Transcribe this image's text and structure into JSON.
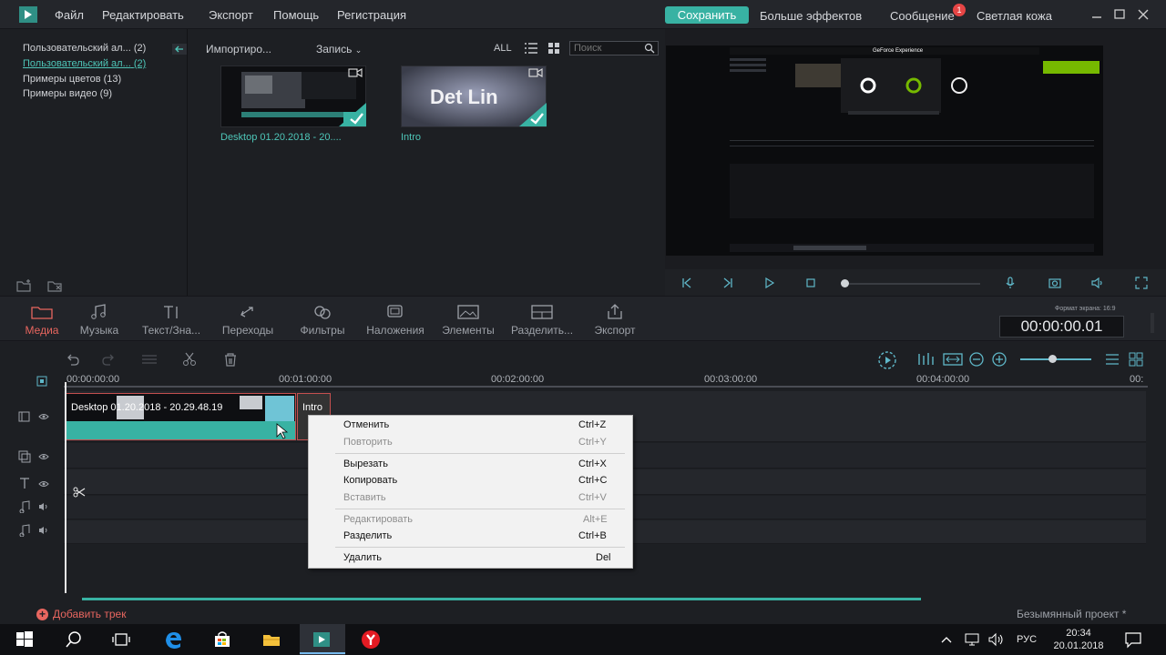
{
  "menubar": {
    "items": [
      "Файл",
      "Редактировать",
      "Экспорт",
      "Помощь",
      "Регистрация"
    ],
    "save_label": "Сохранить",
    "more_effects": "Больше эффектов",
    "messages": "Сообщение",
    "messages_count": "1",
    "theme": "Светлая кожа"
  },
  "library": {
    "folders": [
      {
        "label": "Пользовательский ал...",
        "count": "(2)"
      },
      {
        "label": "Пользовательский ал...",
        "count": "(2)"
      },
      {
        "label": "Примеры цветов (13)",
        "count": ""
      },
      {
        "label": "Примеры видео (9)",
        "count": ""
      }
    ],
    "import_label": "Импортиро...",
    "record_label": "Запись",
    "all_label": "ALL",
    "search_placeholder": "Поиск",
    "media": [
      {
        "name": "Desktop 01.20.2018 - 20...."
      },
      {
        "name": "Intro"
      }
    ],
    "intro_thumb_text": "Det Lin"
  },
  "preview": {
    "screen_title": "GeForce Experience"
  },
  "toolbar": {
    "tools": [
      "Медиа",
      "Музыка",
      "Текст/Зна...",
      "Переходы",
      "Фильтры",
      "Наложения",
      "Элементы",
      "Разделить...",
      "Экспорт"
    ],
    "aspect_label": "Формат экрана: 16:9",
    "timecode": "00:00:00.01"
  },
  "timeline": {
    "ticks": [
      "00:00:00:00",
      "00:01:00:00",
      "00:02:00:00",
      "00:03:00:00",
      "00:04:00:00",
      "00:"
    ],
    "clip1_label": "Desktop 01.20.2018 - 20.29.48.19",
    "clip2_label": "Intro"
  },
  "context_menu": {
    "items": [
      {
        "label": "Отменить",
        "shortcut": "Ctrl+Z",
        "disabled": false
      },
      {
        "label": "Повторить",
        "shortcut": "Ctrl+Y",
        "disabled": true
      },
      {
        "label": "Вырезать",
        "shortcut": "Ctrl+X",
        "disabled": false
      },
      {
        "label": "Копировать",
        "shortcut": "Ctrl+C",
        "disabled": false
      },
      {
        "label": "Вставить",
        "shortcut": "Ctrl+V",
        "disabled": true
      },
      {
        "label": "Редактировать",
        "shortcut": "Alt+E",
        "disabled": true
      },
      {
        "label": "Разделить",
        "shortcut": "Ctrl+B",
        "disabled": false
      },
      {
        "label": "Удалить",
        "shortcut": "Del",
        "disabled": false
      }
    ]
  },
  "bottom": {
    "add_track": "Добавить трек",
    "project_name": "Безымянный проект *"
  },
  "taskbar": {
    "lang": "РУС",
    "time": "20:34",
    "date": "20.01.2018"
  },
  "colors": {
    "accent": "#38b2a3",
    "active_red": "#e8665f"
  }
}
